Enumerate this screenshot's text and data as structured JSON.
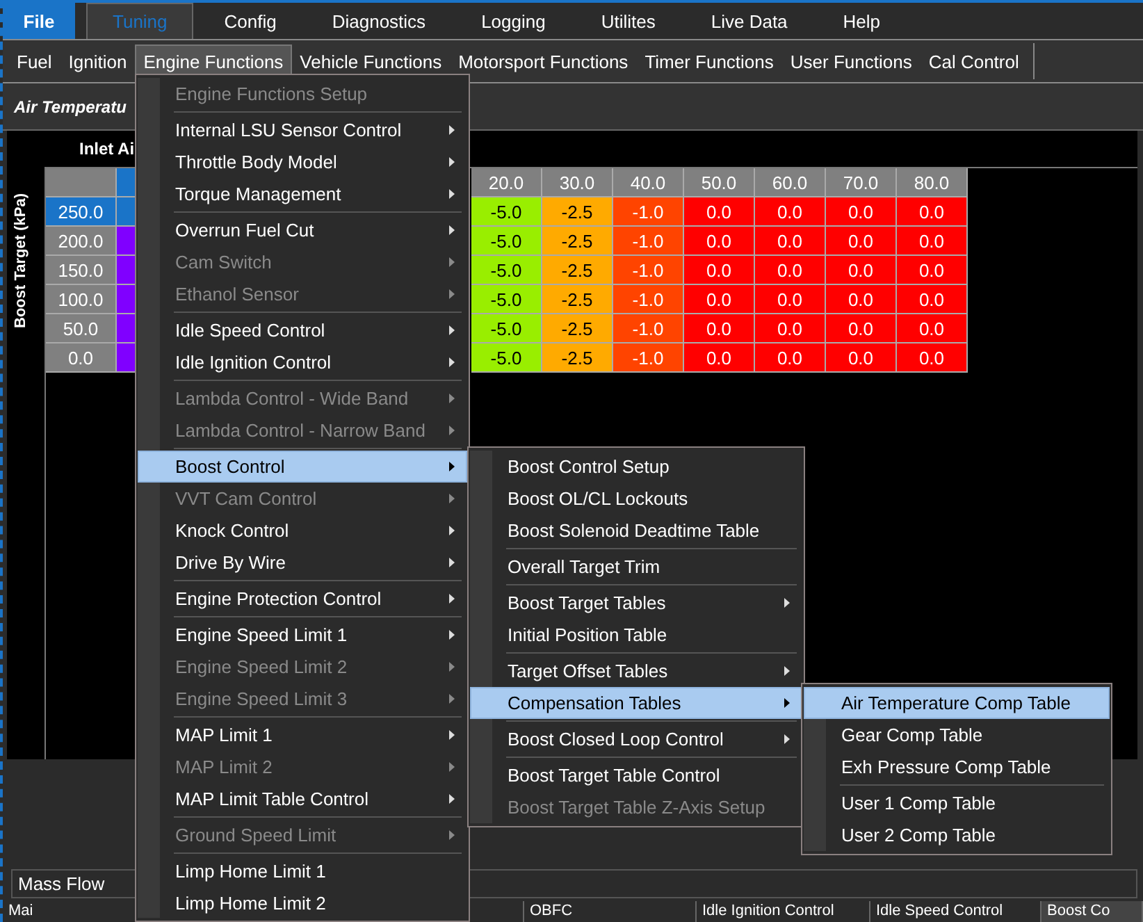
{
  "top_tabs": [
    {
      "label": "File",
      "kind": "file",
      "selected": false
    },
    {
      "label": "Tuning",
      "kind": "tab",
      "selected": true
    },
    {
      "label": "Config",
      "kind": "tab",
      "selected": false
    },
    {
      "label": "Diagnostics",
      "kind": "tab",
      "selected": false
    },
    {
      "label": "Logging",
      "kind": "tab",
      "selected": false
    },
    {
      "label": "Utilites",
      "kind": "tab",
      "selected": false
    },
    {
      "label": "Live Data",
      "kind": "tab",
      "selected": false
    },
    {
      "label": "Help",
      "kind": "tab",
      "selected": false
    }
  ],
  "menu_bar": [
    {
      "label": "Fuel",
      "selected": false
    },
    {
      "label": "Ignition",
      "selected": false
    },
    {
      "label": "Engine Functions",
      "selected": true
    },
    {
      "label": "Vehicle Functions",
      "selected": false
    },
    {
      "label": "Motorsport Functions",
      "selected": false
    },
    {
      "label": "Timer Functions",
      "selected": false
    },
    {
      "label": "User Functions",
      "selected": false
    },
    {
      "label": "Cal Control",
      "selected": false
    }
  ],
  "page_title": "Air Temperatu",
  "table": {
    "x_axis_label": "Inlet Ai",
    "y_axis_label": "Boost Target (kPa)",
    "first_column_selected": true,
    "columns": [
      "20.0",
      "30.0",
      "40.0",
      "50.0",
      "60.0",
      "70.0",
      "80.0"
    ],
    "rows": [
      {
        "label": "250.0",
        "selected": true,
        "first_cell": {
          "color": "#1a74c8"
        },
        "cells": [
          {
            "value": "-5.0",
            "color": "#99ee00"
          },
          {
            "value": "-2.5",
            "color": "#ffaa00"
          },
          {
            "value": "-1.0",
            "color": "#ff4400"
          },
          {
            "value": "0.0",
            "color": "#ff0000"
          },
          {
            "value": "0.0",
            "color": "#ff0000"
          },
          {
            "value": "0.0",
            "color": "#ff0000"
          },
          {
            "value": "0.0",
            "color": "#ff0000"
          }
        ]
      },
      {
        "label": "200.0",
        "selected": false,
        "first_cell": {
          "color": "#8000ff"
        },
        "cells": [
          {
            "value": "-5.0",
            "color": "#99ee00"
          },
          {
            "value": "-2.5",
            "color": "#ffaa00"
          },
          {
            "value": "-1.0",
            "color": "#ff4400"
          },
          {
            "value": "0.0",
            "color": "#ff0000"
          },
          {
            "value": "0.0",
            "color": "#ff0000"
          },
          {
            "value": "0.0",
            "color": "#ff0000"
          },
          {
            "value": "0.0",
            "color": "#ff0000"
          }
        ]
      },
      {
        "label": "150.0",
        "selected": false,
        "first_cell": {
          "color": "#8000ff"
        },
        "cells": [
          {
            "value": "-5.0",
            "color": "#99ee00"
          },
          {
            "value": "-2.5",
            "color": "#ffaa00"
          },
          {
            "value": "-1.0",
            "color": "#ff4400"
          },
          {
            "value": "0.0",
            "color": "#ff0000"
          },
          {
            "value": "0.0",
            "color": "#ff0000"
          },
          {
            "value": "0.0",
            "color": "#ff0000"
          },
          {
            "value": "0.0",
            "color": "#ff0000"
          }
        ]
      },
      {
        "label": "100.0",
        "selected": false,
        "first_cell": {
          "color": "#8000ff"
        },
        "cells": [
          {
            "value": "-5.0",
            "color": "#99ee00"
          },
          {
            "value": "-2.5",
            "color": "#ffaa00"
          },
          {
            "value": "-1.0",
            "color": "#ff4400"
          },
          {
            "value": "0.0",
            "color": "#ff0000"
          },
          {
            "value": "0.0",
            "color": "#ff0000"
          },
          {
            "value": "0.0",
            "color": "#ff0000"
          },
          {
            "value": "0.0",
            "color": "#ff0000"
          }
        ]
      },
      {
        "label": "50.0",
        "selected": false,
        "first_cell": {
          "color": "#8000ff"
        },
        "cells": [
          {
            "value": "-5.0",
            "color": "#99ee00"
          },
          {
            "value": "-2.5",
            "color": "#ffaa00"
          },
          {
            "value": "-1.0",
            "color": "#ff4400"
          },
          {
            "value": "0.0",
            "color": "#ff0000"
          },
          {
            "value": "0.0",
            "color": "#ff0000"
          },
          {
            "value": "0.0",
            "color": "#ff0000"
          },
          {
            "value": "0.0",
            "color": "#ff0000"
          }
        ]
      },
      {
        "label": "0.0",
        "selected": false,
        "first_cell": {
          "color": "#8000ff"
        },
        "cells": [
          {
            "value": "-5.0",
            "color": "#99ee00"
          },
          {
            "value": "-2.5",
            "color": "#ffaa00"
          },
          {
            "value": "-1.0",
            "color": "#ff4400"
          },
          {
            "value": "0.0",
            "color": "#ff0000"
          },
          {
            "value": "0.0",
            "color": "#ff0000"
          },
          {
            "value": "0.0",
            "color": "#ff0000"
          },
          {
            "value": "0.0",
            "color": "#ff0000"
          }
        ]
      }
    ]
  },
  "list_item": "Mass Flow",
  "bottom_tabs": [
    {
      "label": "Mai",
      "selected": false
    },
    {
      "label": "OBFC",
      "selected": false
    },
    {
      "label": "Idle Ignition Control",
      "selected": false
    },
    {
      "label": "Idle Speed Control",
      "selected": false
    },
    {
      "label": "Boost Co",
      "selected": true
    }
  ],
  "menus": [
    {
      "items": [
        {
          "kind": "item",
          "label": "Engine Functions Setup",
          "disabled": true,
          "submenu": false,
          "selected": false
        },
        {
          "kind": "separator"
        },
        {
          "kind": "item",
          "label": "Internal LSU Sensor Control",
          "disabled": false,
          "submenu": true,
          "selected": false
        },
        {
          "kind": "item",
          "label": "Throttle Body Model",
          "disabled": false,
          "submenu": true,
          "selected": false
        },
        {
          "kind": "item",
          "label": "Torque Management",
          "disabled": false,
          "submenu": true,
          "selected": false
        },
        {
          "kind": "separator"
        },
        {
          "kind": "item",
          "label": "Overrun Fuel Cut",
          "disabled": false,
          "submenu": true,
          "selected": false
        },
        {
          "kind": "item",
          "label": "Cam Switch",
          "disabled": true,
          "submenu": true,
          "selected": false
        },
        {
          "kind": "item",
          "label": "Ethanol Sensor",
          "disabled": true,
          "submenu": true,
          "selected": false
        },
        {
          "kind": "separator"
        },
        {
          "kind": "item",
          "label": "Idle Speed Control",
          "disabled": false,
          "submenu": true,
          "selected": false
        },
        {
          "kind": "item",
          "label": "Idle Ignition Control",
          "disabled": false,
          "submenu": true,
          "selected": false
        },
        {
          "kind": "separator"
        },
        {
          "kind": "item",
          "label": "Lambda Control - Wide Band",
          "disabled": true,
          "submenu": true,
          "selected": false
        },
        {
          "kind": "item",
          "label": "Lambda Control - Narrow Band",
          "disabled": true,
          "submenu": true,
          "selected": false
        },
        {
          "kind": "separator"
        },
        {
          "kind": "item",
          "label": "Boost Control",
          "disabled": false,
          "submenu": true,
          "selected": true
        },
        {
          "kind": "item",
          "label": "VVT Cam Control",
          "disabled": true,
          "submenu": true,
          "selected": false
        },
        {
          "kind": "item",
          "label": "Knock Control",
          "disabled": false,
          "submenu": true,
          "selected": false
        },
        {
          "kind": "item",
          "label": "Drive By Wire",
          "disabled": false,
          "submenu": true,
          "selected": false
        },
        {
          "kind": "separator"
        },
        {
          "kind": "item",
          "label": "Engine Protection Control",
          "disabled": false,
          "submenu": true,
          "selected": false
        },
        {
          "kind": "separator"
        },
        {
          "kind": "item",
          "label": "Engine Speed Limit 1",
          "disabled": false,
          "submenu": true,
          "selected": false
        },
        {
          "kind": "item",
          "label": "Engine Speed Limit 2",
          "disabled": true,
          "submenu": true,
          "selected": false
        },
        {
          "kind": "item",
          "label": "Engine Speed Limit 3",
          "disabled": true,
          "submenu": true,
          "selected": false
        },
        {
          "kind": "separator"
        },
        {
          "kind": "item",
          "label": "MAP Limit 1",
          "disabled": false,
          "submenu": true,
          "selected": false
        },
        {
          "kind": "item",
          "label": "MAP Limit 2",
          "disabled": true,
          "submenu": true,
          "selected": false
        },
        {
          "kind": "item",
          "label": "MAP Limit Table Control",
          "disabled": false,
          "submenu": true,
          "selected": false
        },
        {
          "kind": "separator"
        },
        {
          "kind": "item",
          "label": "Ground Speed Limit",
          "disabled": true,
          "submenu": true,
          "selected": false
        },
        {
          "kind": "separator"
        },
        {
          "kind": "item",
          "label": "Limp Home Limit 1",
          "disabled": false,
          "submenu": false,
          "selected": false
        },
        {
          "kind": "item",
          "label": "Limp Home Limit 2",
          "disabled": false,
          "submenu": false,
          "selected": false
        }
      ]
    },
    {
      "items": [
        {
          "kind": "item",
          "label": "Boost Control Setup",
          "disabled": false,
          "submenu": false,
          "selected": false
        },
        {
          "kind": "item",
          "label": "Boost OL/CL Lockouts",
          "disabled": false,
          "submenu": false,
          "selected": false
        },
        {
          "kind": "item",
          "label": "Boost Solenoid Deadtime Table",
          "disabled": false,
          "submenu": false,
          "selected": false
        },
        {
          "kind": "separator"
        },
        {
          "kind": "item",
          "label": "Overall Target Trim",
          "disabled": false,
          "submenu": false,
          "selected": false
        },
        {
          "kind": "separator"
        },
        {
          "kind": "item",
          "label": "Boost Target Tables",
          "disabled": false,
          "submenu": true,
          "selected": false
        },
        {
          "kind": "item",
          "label": "Initial Position Table",
          "disabled": false,
          "submenu": false,
          "selected": false
        },
        {
          "kind": "separator"
        },
        {
          "kind": "item",
          "label": "Target Offset Tables",
          "disabled": false,
          "submenu": true,
          "selected": false
        },
        {
          "kind": "item",
          "label": "Compensation Tables",
          "disabled": false,
          "submenu": true,
          "selected": true
        },
        {
          "kind": "separator"
        },
        {
          "kind": "item",
          "label": "Boost Closed Loop Control",
          "disabled": false,
          "submenu": true,
          "selected": false
        },
        {
          "kind": "separator"
        },
        {
          "kind": "item",
          "label": "Boost Target Table Control",
          "disabled": false,
          "submenu": false,
          "selected": false
        },
        {
          "kind": "item",
          "label": "Boost Target Table Z-Axis Setup",
          "disabled": true,
          "submenu": false,
          "selected": false
        }
      ]
    },
    {
      "items": [
        {
          "kind": "item",
          "label": "Air Temperature Comp Table",
          "disabled": false,
          "submenu": false,
          "selected": true
        },
        {
          "kind": "item",
          "label": "Gear Comp Table",
          "disabled": false,
          "submenu": false,
          "selected": false
        },
        {
          "kind": "item",
          "label": "Exh Pressure Comp Table",
          "disabled": false,
          "submenu": false,
          "selected": false
        },
        {
          "kind": "separator"
        },
        {
          "kind": "item",
          "label": "User 1 Comp Table",
          "disabled": false,
          "submenu": false,
          "selected": false
        },
        {
          "kind": "item",
          "label": "User 2 Comp Table",
          "disabled": false,
          "submenu": false,
          "selected": false
        }
      ]
    }
  ]
}
